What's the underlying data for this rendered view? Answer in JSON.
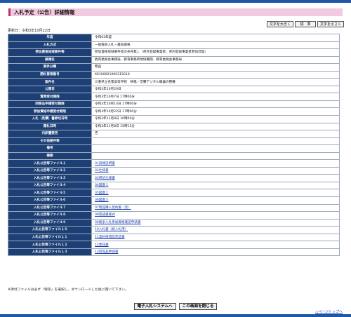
{
  "page": {
    "title": "入札予定（公告）詳細情報"
  },
  "font_controls": {
    "larger": "文字を大きく",
    "standard": "標　準",
    "smaller": "文字を小さく"
  },
  "update_date": "更新日：令和3年10月22日",
  "details": [
    {
      "label": "年度",
      "value": "令和03年度"
    },
    {
      "label": "入札方式",
      "value": "一般競争入札・最低価格"
    },
    {
      "label": "参加資格地域要件等",
      "value": "参加資格地域要件等の条件無し（県外登録事業者、県内登録事業者参加可能）"
    },
    {
      "label": "調達名",
      "value": "教育委員会事務局、教育事務所地域機関、教育委員会事務局"
    },
    {
      "label": "案件分類",
      "value": "物品"
    },
    {
      "label": "開札管理番号",
      "value": "60100021090315010"
    },
    {
      "label": "案件名",
      "value": "三重県立名張高等学校　映像／音響デジタル機器の整備"
    },
    {
      "label": "公開日",
      "value": "令和3年10月20日"
    },
    {
      "label": "質問受付期限",
      "value": "令和3年10月7日 17時00分"
    },
    {
      "label": "同等品申請受付期限",
      "value": "令和3年10月14日 17時00分"
    },
    {
      "label": "参加資格申請受付期限",
      "value": "令和3年10月22日 17時00分"
    },
    {
      "label": "入札（見積）書締切日時",
      "value": "令和3年11月8日 10時00分"
    },
    {
      "label": "開札日時",
      "value": "令和3年11月8日 15時15分"
    },
    {
      "label": "内訳書要否",
      "value": "否"
    },
    {
      "label": "その他要件等",
      "value": ""
    },
    {
      "label": "備考",
      "value": ""
    },
    {
      "label": "摘要",
      "value": ""
    }
  ],
  "files": [
    {
      "label": "入札公告等ファイル１",
      "link": "01調達説明書"
    },
    {
      "label": "入札公告等ファイル２",
      "link": "02仕様書"
    },
    {
      "label": "入札公告等ファイル３",
      "link": "03特記仕様書"
    },
    {
      "label": "入札公告等ファイル４",
      "link": "04図面１"
    },
    {
      "label": "入札公告等ファイル５",
      "link": "05図面２"
    },
    {
      "label": "入札公告等ファイル６",
      "link": "06図面３"
    },
    {
      "label": "入札公告等ファイル７",
      "link": "07物品購入契約書（案）"
    },
    {
      "label": "入札公告等ファイル８",
      "link": "08質疑書様式"
    },
    {
      "label": "入札公告等ファイル９",
      "link": "09競争入札参加資格確認申請書"
    },
    {
      "label": "入札公告等ファイル１０",
      "link": "10入札書（総入札用）"
    },
    {
      "label": "入札公告等ファイル１１",
      "link": "11契約保證認定証書"
    },
    {
      "label": "入札公告等ファイル１２",
      "link": "12委任書"
    },
    {
      "label": "入札公告等ファイル１３",
      "link": "13同等品申請書"
    }
  ],
  "note": "※添付ファイルは必ず「保存」を選択し、ダウンロードした後に開いて下さい。",
  "actions": {
    "system": "電子入札システムへ",
    "close": "この画面を閉じる"
  },
  "page_top": "△ページトップへ"
}
